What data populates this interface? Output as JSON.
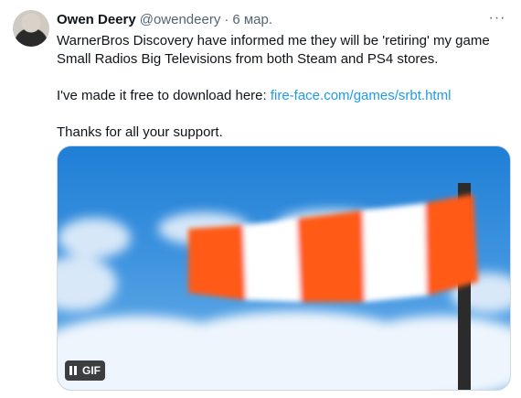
{
  "tweet": {
    "author_name": "Owen Deery",
    "author_handle": "@owendeery",
    "separator": "·",
    "date": "6 мар.",
    "more_label": "···",
    "text": {
      "line1": "WarnerBros Discovery have informed me they will be 'retiring' my game Small Radios Big Televisions from both Steam and PS4 stores.",
      "line2_prefix": "I've made it free to download here: ",
      "link": "fire-face.com/games/srbt.html",
      "line3": "Thanks for all your support."
    },
    "media": {
      "badge": "GIF",
      "colors": {
        "sky": "#1f7fd6",
        "orange": "#ff5a14",
        "white": "#ffffff",
        "pole": "#2b2b2b"
      }
    }
  }
}
